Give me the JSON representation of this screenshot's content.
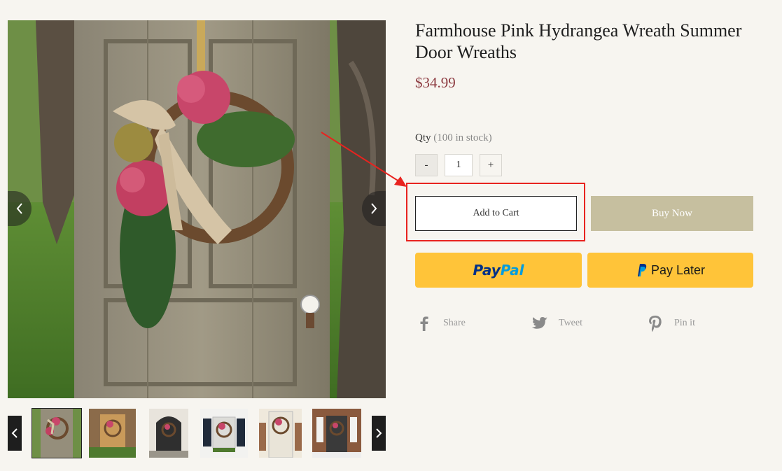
{
  "product": {
    "title": "Farmhouse Pink Hydrangea Wreath Summer Door Wreaths",
    "price": "$34.99"
  },
  "quantity": {
    "label": "Qty",
    "stock_text": "(100 in stock)",
    "minus_label": "-",
    "plus_label": "+",
    "value": "1"
  },
  "actions": {
    "add_to_cart": "Add to Cart",
    "buy_now": "Buy Now",
    "paypal_pay": "Pay",
    "paypal_pal": "Pal",
    "pay_later": "Pay Later"
  },
  "share": [
    {
      "label": "Share",
      "icon": "facebook-icon"
    },
    {
      "label": "Tweet",
      "icon": "twitter-icon"
    },
    {
      "label": "Pin it",
      "icon": "pinterest-icon"
    }
  ],
  "gallery": {
    "thumbnail_count": 6,
    "active_thumbnail": 1
  },
  "colors": {
    "price": "#8c3a40",
    "buy_now_bg": "#c6bf9f",
    "paypal_bg": "#ffc439",
    "annotation": "#e8231f"
  }
}
